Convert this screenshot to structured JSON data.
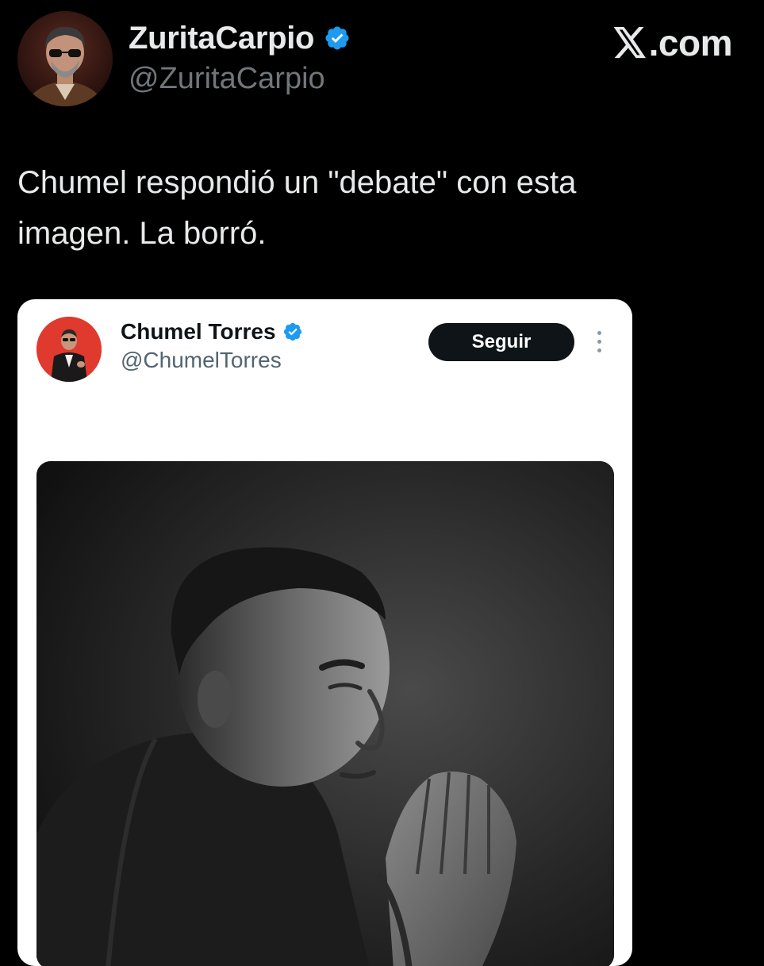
{
  "outer_tweet": {
    "author_name": "ZuritaCarpio",
    "author_handle": "@ZuritaCarpio",
    "verified_icon": "verified-badge-icon",
    "text_line_1": "Chumel respondió un \"debate\" con esta",
    "text_line_2": "imagen. La borró."
  },
  "brand": {
    "label": ".com",
    "icon": "x-logo-icon"
  },
  "embedded_tweet": {
    "author_name": "Chumel Torres",
    "author_handle": "@ChumelTorres",
    "verified_icon": "verified-badge-icon",
    "follow_label": "Seguir",
    "more_icon": "more-options-icon",
    "media_description_icon": "photo"
  },
  "colors": {
    "background": "#000000",
    "verified_blue": "#1d9bf0",
    "card_background": "#ffffff",
    "follow_button": "#0f1419",
    "secondary_text_dark": "#71767b",
    "secondary_text_light": "#536471"
  }
}
